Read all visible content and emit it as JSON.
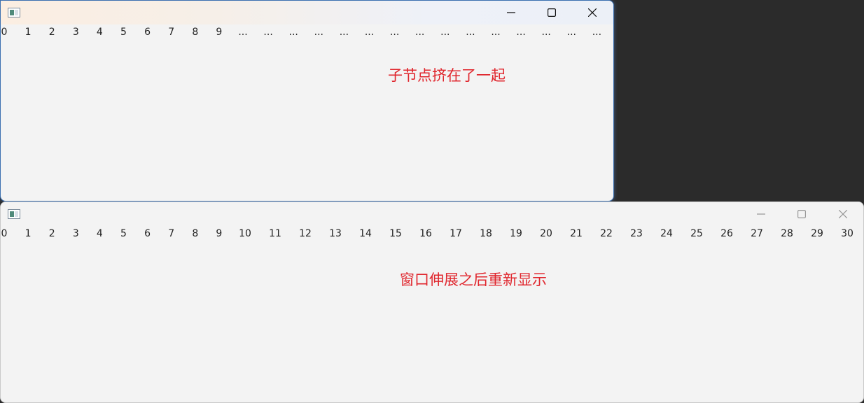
{
  "window_top": {
    "ticks": [
      "0",
      "1",
      "2",
      "3",
      "4",
      "5",
      "6",
      "7",
      "8",
      "9",
      "...",
      "...",
      "...",
      "...",
      "...",
      "...",
      "...",
      "...",
      "...",
      "...",
      "...",
      "...",
      "...",
      "...",
      "..."
    ],
    "annotation": "子节点挤在了一起",
    "controls": {
      "minimize": "minimize-icon",
      "maximize": "maximize-icon",
      "close": "close-icon"
    }
  },
  "window_bottom": {
    "ticks": [
      "0",
      "1",
      "2",
      "3",
      "4",
      "5",
      "6",
      "7",
      "8",
      "9",
      "10",
      "11",
      "12",
      "13",
      "14",
      "15",
      "16",
      "17",
      "18",
      "19",
      "20",
      "21",
      "22",
      "23",
      "24",
      "25",
      "26",
      "27",
      "28",
      "29",
      "30"
    ],
    "annotation": "窗口伸展之后重新显示",
    "controls": {
      "minimize": "minimize-icon",
      "maximize": "maximize-icon",
      "close": "close-icon"
    }
  },
  "colors": {
    "annotation": "#e0262d",
    "window_background": "#f3f3f3",
    "desktop": "#2b2b2b"
  }
}
